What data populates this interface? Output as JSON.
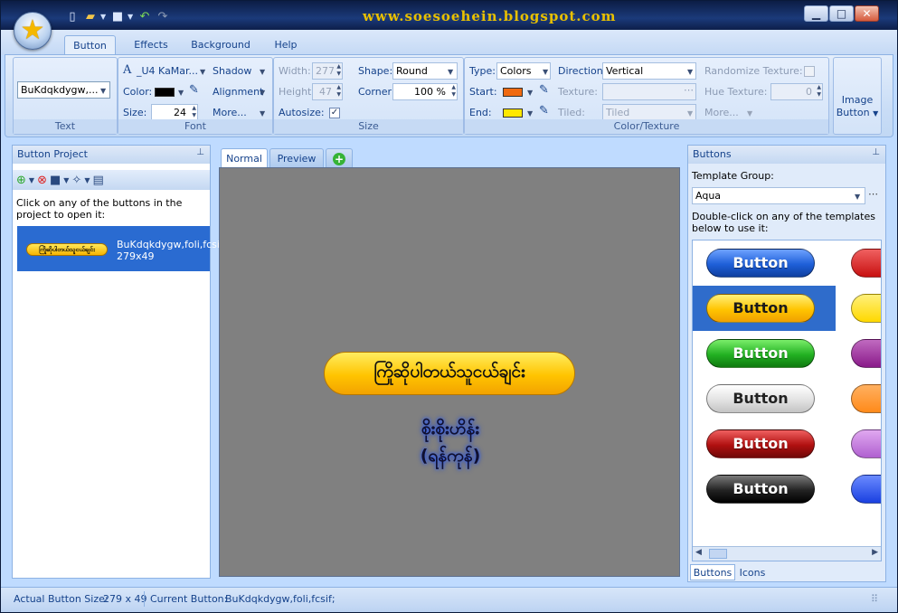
{
  "window": {
    "title": "www.soesoehein.blogspot.com",
    "controls": {
      "minimize": "▁",
      "maximize": "□",
      "close": "✕"
    }
  },
  "ribbon": {
    "tabs": [
      "Button",
      "Effects",
      "Background",
      "Help"
    ],
    "active_tab": "Button",
    "text_group": {
      "caption": "Text",
      "text_value": "BuKdqkdygw,..."
    },
    "font_group": {
      "caption": "Font",
      "font_name": "_U4 KaMar...",
      "shadow_label": "Shadow",
      "color_label": "Color:",
      "alignment_label": "Alignment",
      "size_label": "Size:",
      "size_value": "24",
      "more_label": "More...",
      "font_color": "#000000"
    },
    "size_group": {
      "caption": "Size",
      "width_label": "Width:",
      "width_value": "277",
      "height_label": "Height:",
      "height_value": "47",
      "autosize_label": "Autosize:",
      "shape_label": "Shape:",
      "shape_value": "Round",
      "corner_label": "Corner:",
      "corner_value": "100 %"
    },
    "color_group": {
      "caption": "Color/Texture",
      "type_label": "Type:",
      "type_value": "Colors",
      "start_label": "Start:",
      "start_color": "#f06a10",
      "end_label": "End:",
      "end_color": "#ffe800",
      "direction_label": "Direction:",
      "direction_value": "Vertical",
      "texture_label": "Texture:",
      "tiled_label": "Tiled:",
      "tiled_value": "Tiled",
      "randomize_label": "Randomize Texture:",
      "hue_label": "Hue Texture:",
      "hue_value": "0",
      "more_label": "More..."
    },
    "image_button": {
      "label1": "Image",
      "label2": "Button"
    }
  },
  "left_panel": {
    "title": "Button Project",
    "instruction": "Click on any of the buttons in the project to open it:",
    "item": {
      "name": "BuKdqkdygw,foli,fcsif;",
      "size": "279x49",
      "thumb_text": "ကြိုဆိုပါတယ်သူငယ်ချင်း"
    }
  },
  "center": {
    "tabs": [
      "Normal",
      "Preview",
      "+"
    ],
    "button_text": "ကြိုဆိုပါတယ်သူငယ်ချင်း",
    "credit_line1": "စိုးစိုးဟိန်း",
    "credit_line2": "(ရန်ကုန်)"
  },
  "right_panel": {
    "title": "Buttons",
    "template_group_label": "Template Group:",
    "template_group_value": "Aqua",
    "instruction": "Double-click on any of the templates below to use it:",
    "template_label": "Button",
    "templates": [
      {
        "color": "#2262e0",
        "right_color": "#c81010"
      },
      {
        "color": "#ffc400",
        "right_color": "#ffd800"
      },
      {
        "color": "#22b022",
        "right_color": "#8a1a8a"
      },
      {
        "color": "#e8e8e8",
        "right_color": "#ff8a1a"
      },
      {
        "color": "#b01010",
        "right_color": "#b060d0"
      },
      {
        "color": "#222222",
        "right_color": "#1a40e0"
      }
    ],
    "bottom_tabs": [
      "Buttons",
      "Icons"
    ]
  },
  "status": {
    "actual_size_label": "Actual Button Size:",
    "actual_size_value": "279 x 49",
    "current_label": "Current Button:",
    "current_value": "BuKdqkdygw,foli,fcsif;"
  }
}
